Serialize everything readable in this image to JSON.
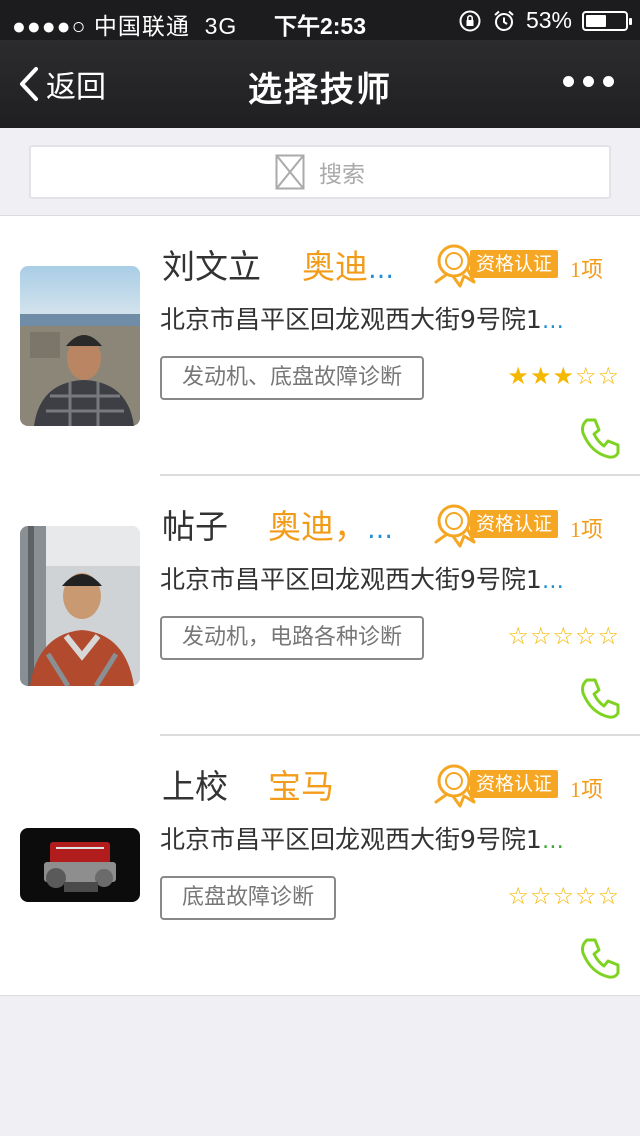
{
  "status_bar": {
    "signal": "●●●●○ 中国联通",
    "network": "3G",
    "time": "下午2:53",
    "battery": "53%",
    "battery_level": 0.53
  },
  "nav": {
    "back_label": "返回",
    "title": "选择技师",
    "more_icon": "more-dots-icon"
  },
  "search": {
    "placeholder": "搜索"
  },
  "colors": {
    "brand_text": "#f39c1a",
    "badge": "#f5a623",
    "phone_icon": "#7ed321",
    "ellipsis_blue": "#1e8fd6",
    "ellipsis_green": "#3aa935"
  },
  "technicians": [
    {
      "name": "刘文立",
      "brand": "奥迪",
      "brand_ellipsis": "…",
      "cert_label": "资格认证",
      "cert_count": "1项",
      "address": "北京市昌平区回龙观西大街9号院1",
      "address_ellipsis": "…",
      "specialty": "发动机、底盘故障诊断",
      "stars_text": "★★★☆☆",
      "rating": 3
    },
    {
      "name": "帖子",
      "brand": "奥迪，",
      "brand_ellipsis": "…",
      "cert_label": "资格认证",
      "cert_count": "1项",
      "address": "北京市昌平区回龙观西大街9号院1",
      "address_ellipsis": "…",
      "specialty": "发动机，电路各种诊断",
      "stars_text": "☆☆☆☆☆",
      "rating": 0
    },
    {
      "name": "上校",
      "brand": "宝马",
      "brand_ellipsis": "",
      "cert_label": "资格认证",
      "cert_count": "1项",
      "address": "北京市昌平区回龙观西大街9号院1",
      "address_ellipsis": "…",
      "specialty": "底盘故障诊断",
      "stars_text": "☆☆☆☆☆",
      "rating": 0
    }
  ]
}
